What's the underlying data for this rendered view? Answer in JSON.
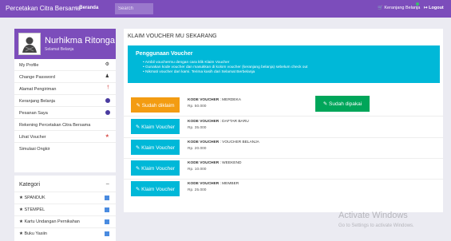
{
  "topbar": {
    "brand": "Percetakan Citra Bersama",
    "home": "⌂ Beranda",
    "search_placeholder": "Search",
    "cart": "🛒 Keranjang Belanja",
    "logout": "↦ Logout"
  },
  "profile": {
    "name": "Nurhikma Ritonga",
    "greeting": "Selamat Belanja"
  },
  "sidebar": {
    "items": [
      {
        "label": "My Profile",
        "icon": "⚙"
      },
      {
        "label": "Change Password",
        "icon": "♟"
      },
      {
        "label": "Alamat Pengiriman",
        "icon": "†"
      },
      {
        "label": "Keranjang Belanja",
        "icon": ""
      },
      {
        "label": "Pesanan Saya",
        "icon": ""
      },
      {
        "label": "Rekening Percetakan Citra Bersama",
        "icon": ""
      },
      {
        "label": "Lihat Voucher",
        "icon": "★"
      },
      {
        "label": "Simulasi Ongkir",
        "icon": ""
      }
    ]
  },
  "categories": {
    "title": "Kategori",
    "collapse": "−",
    "items": [
      "★ SPANDUK",
      "★ STEMPEL",
      "★ Kartu Undangan Pernikahan",
      "★ Buku Yasiin"
    ]
  },
  "panel": {
    "title": "KLAIM VOUCHER MU SEKARANG",
    "info_title": "Penggunaan Voucher",
    "info_items": [
      "•  Ambil vouchermu dengan cara klik Klaim Voucher",
      "•  Gunakan kode voucher dan masukkan di kolom voucher (keranjang belanja) sebelum check out",
      "•  Nikmati voucher dari kami. Terima kasih dari Selamat Berbelanja"
    ]
  },
  "vouchers": [
    {
      "button": "✎ Sudah diklaim",
      "code_label": "KODE VOUCHER",
      "code": " : MERDEKA",
      "price": "Rp. 50.000",
      "used": "✎ Sudah dipakai",
      "color": "#f39c12"
    },
    {
      "button": "✎ Klaim Voucher",
      "code_label": "KODE VOUCHER",
      "code": " : DAFTAR BARU",
      "price": "Rp. 35.000",
      "color": "#00b8d8"
    },
    {
      "button": "✎ Klaim Voucher",
      "code_label": "KODE VOUCHER",
      "code": " : VOUCHER BELANJA",
      "price": "Rp. 20.000",
      "color": "#00b8d8"
    },
    {
      "button": "✎ Klaim Voucher",
      "code_label": "KODE VOUCHER",
      "code": " : WEEKEND",
      "price": "Rp. 10.000",
      "color": "#00b8d8"
    },
    {
      "button": "✎ Klaim Voucher",
      "code_label": "KODE VOUCHER",
      "code": " : MEMBER",
      "price": "Rp. 25.000",
      "color": "#00b8d8"
    }
  ],
  "watermark": {
    "line1": "Activate Windows",
    "line2": "Go to Settings to activate Windows."
  }
}
